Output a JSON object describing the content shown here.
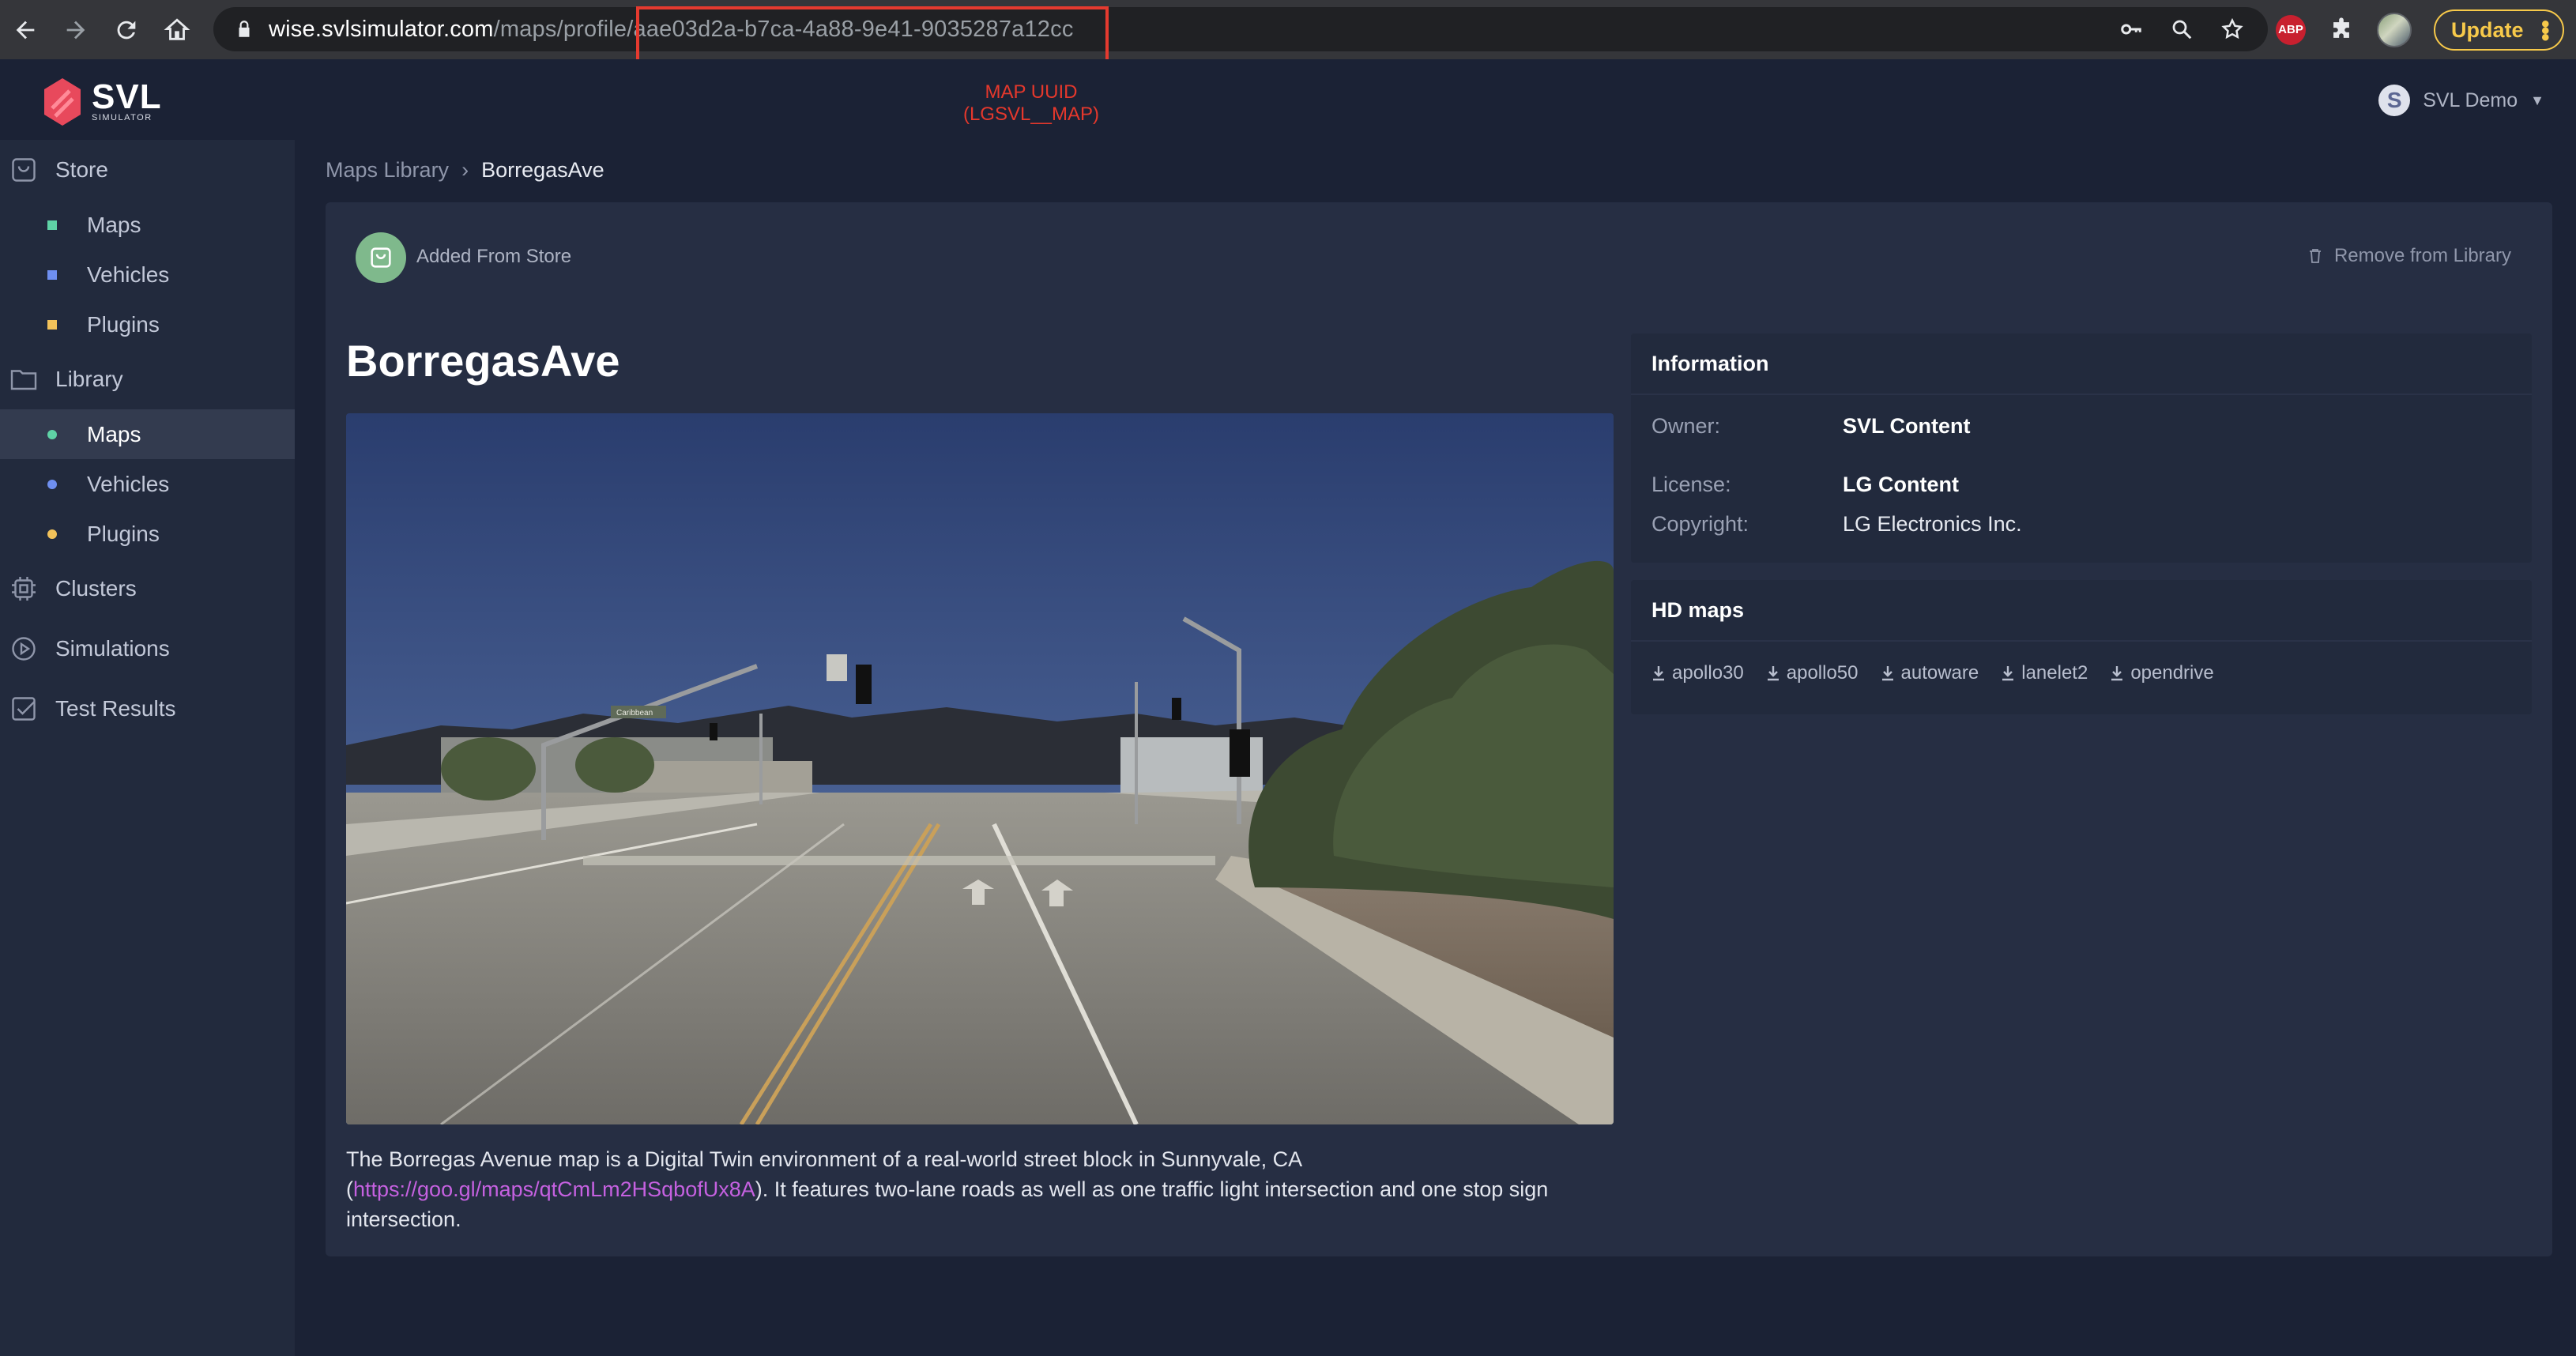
{
  "browser": {
    "url_host": "wise.svlsimulator.com",
    "url_path": "/maps/profile/",
    "url_uuid": "aae03d2a-b7ca-4a88-9e41-9035287a12cc",
    "update_label": "Update",
    "abp_label": "ABP"
  },
  "annotation": {
    "line1": "MAP UUID",
    "line2": "(LGSVL__MAP)"
  },
  "header": {
    "logo_big": "SVL",
    "logo_small": "SIMULATOR",
    "user_initial": "S",
    "user_name": "SVL Demo"
  },
  "sidebar": {
    "store": "Store",
    "store_items": [
      {
        "label": "Maps",
        "color": "#5fd3a6"
      },
      {
        "label": "Vehicles",
        "color": "#6f8ff0"
      },
      {
        "label": "Plugins",
        "color": "#f2c25a"
      }
    ],
    "library": "Library",
    "library_items": [
      {
        "label": "Maps",
        "color": "#5fd3a6"
      },
      {
        "label": "Vehicles",
        "color": "#6f8ff0"
      },
      {
        "label": "Plugins",
        "color": "#f2c25a"
      }
    ],
    "clusters": "Clusters",
    "simulations": "Simulations",
    "test_results": "Test Results"
  },
  "breadcrumb": {
    "parent": "Maps Library",
    "separator": "›",
    "current": "BorregasAve"
  },
  "card": {
    "added_label": "Added From Store",
    "remove_label": "Remove from Library",
    "title": "BorregasAve",
    "description_pre": "The Borregas Avenue map is a Digital Twin environment of a real-world street block in Sunnyvale, CA (",
    "description_link": "https://goo.gl/maps/qtCmLm2HSqbofUx8A",
    "description_post": "). It features two-lane roads as well as one traffic light intersection and one stop sign intersection.",
    "street_sign": "Caribbean"
  },
  "information": {
    "heading": "Information",
    "owner_label": "Owner:",
    "owner_value": "SVL Content",
    "license_label": "License:",
    "license_value": "LG Content",
    "copyright_label": "Copyright:",
    "copyright_value": "LG Electronics Inc."
  },
  "hd_maps": {
    "heading": "HD maps",
    "items": [
      "apollo30",
      "apollo50",
      "autoware",
      "lanelet2",
      "opendrive"
    ]
  }
}
